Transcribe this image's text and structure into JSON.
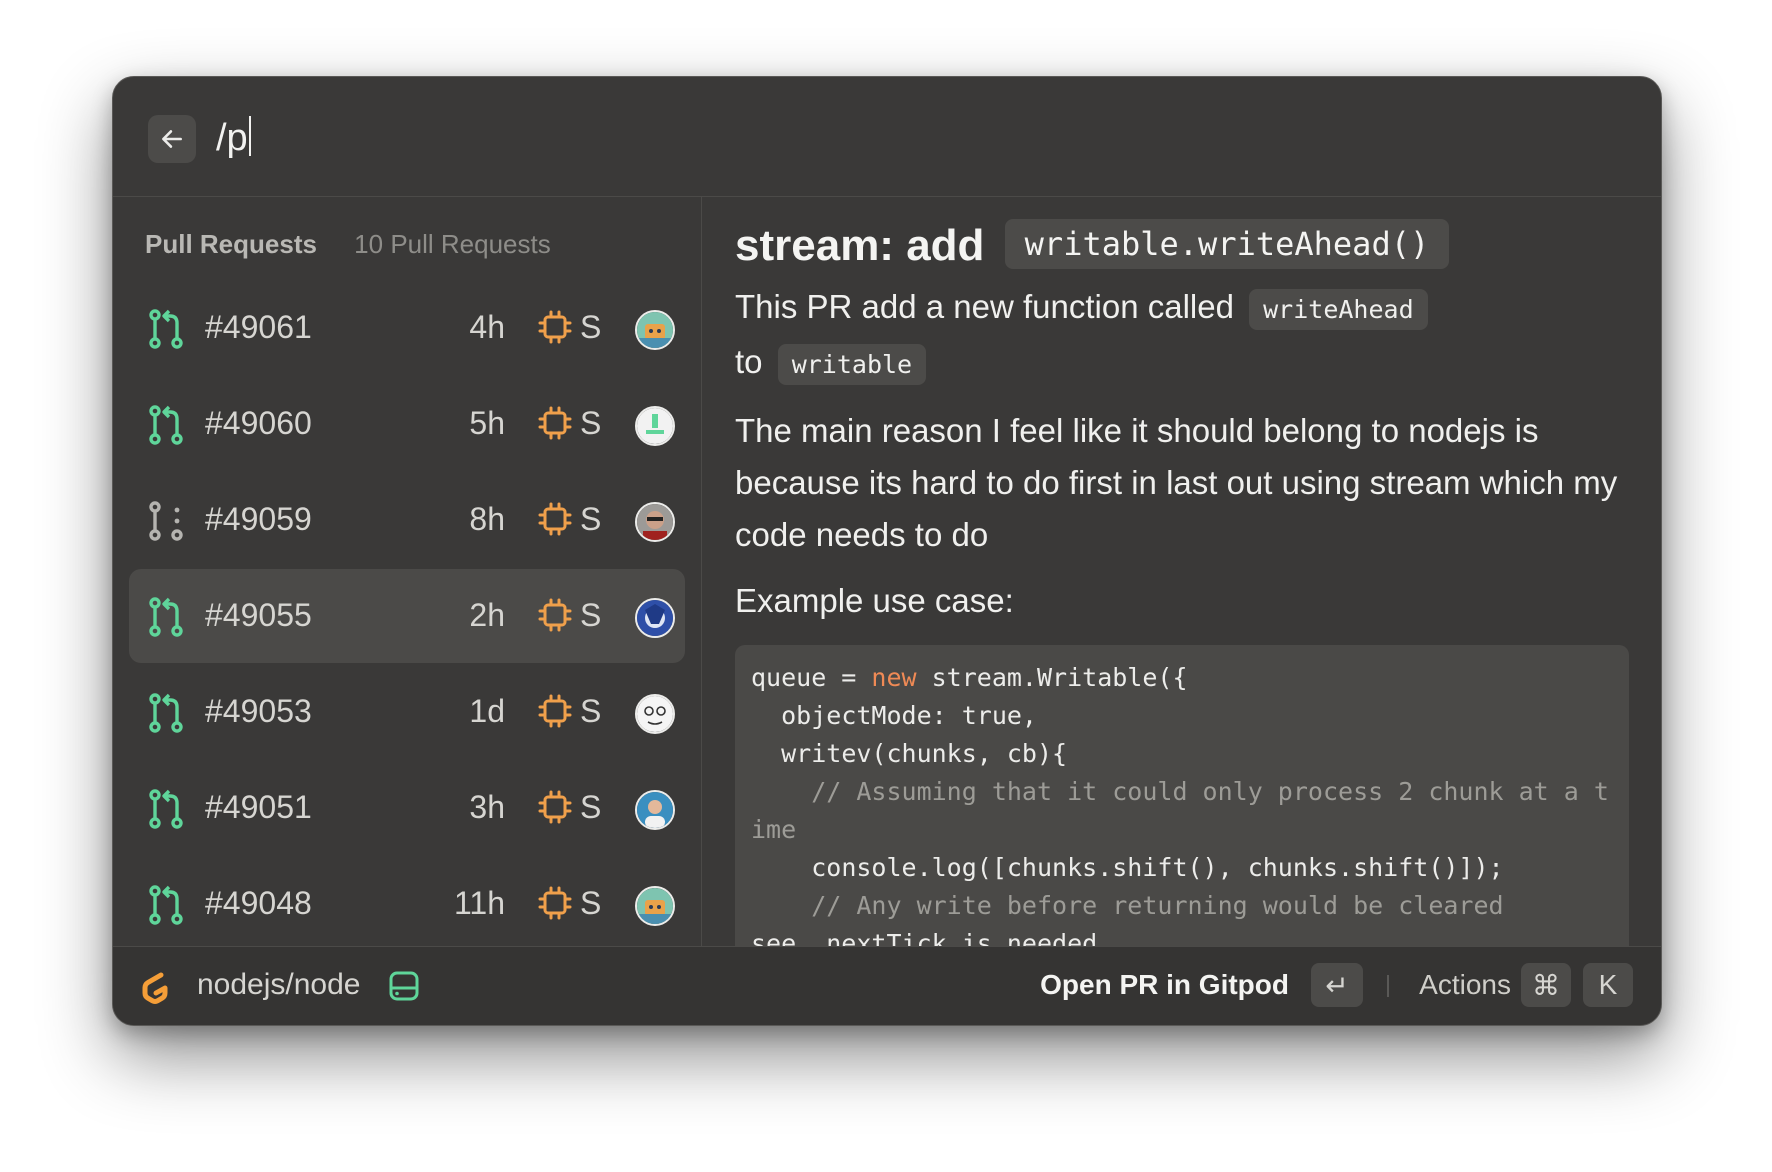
{
  "search": {
    "query": "/p"
  },
  "list": {
    "title": "Pull Requests",
    "count_label": "10 Pull Requests",
    "items": [
      {
        "number": "#49061",
        "age": "4h",
        "size": "S",
        "status": "open",
        "avatar": "avatar-1"
      },
      {
        "number": "#49060",
        "age": "5h",
        "size": "S",
        "status": "open",
        "avatar": "avatar-2"
      },
      {
        "number": "#49059",
        "age": "8h",
        "size": "S",
        "status": "draft",
        "avatar": "avatar-3"
      },
      {
        "number": "#49055",
        "age": "2h",
        "size": "S",
        "status": "open",
        "avatar": "avatar-4",
        "selected": true
      },
      {
        "number": "#49053",
        "age": "1d",
        "size": "S",
        "status": "open",
        "avatar": "avatar-5"
      },
      {
        "number": "#49051",
        "age": "3h",
        "size": "S",
        "status": "open",
        "avatar": "avatar-6"
      },
      {
        "number": "#49048",
        "age": "11h",
        "size": "S",
        "status": "open",
        "avatar": "avatar-1"
      }
    ]
  },
  "detail": {
    "title_prefix": "stream: add",
    "title_code": "writable.writeAhead()",
    "p1_text": "This PR add a new function called",
    "p1_code": "writeAhead",
    "p1_to": "to",
    "p1_code2": "writable",
    "p2": "The main reason I feel like it should belong to nodejs is because its hard to do first in last out using stream which my code needs to do",
    "p3": "Example use case:",
    "code": {
      "l1a": "queue = ",
      "l1kw": "new",
      "l1b": " stream.Writable({",
      "l2": "  objectMode: true,",
      "l3": "  writev(chunks, cb){",
      "l4": "    // Assuming that it could only process 2 chunk at a time",
      "l5": "    console.log([chunks.shift(), chunks.shift()]);",
      "l6": "    // Any write before returning would be cleared",
      "l7": "see .nextTick is needed"
    }
  },
  "footer": {
    "repo": "nodejs/node",
    "primary_action": "Open PR in Gitpod",
    "enter_key": "↵",
    "actions_label": "Actions",
    "cmd_key": "⌘",
    "k_key": "K"
  },
  "colors": {
    "accent_green": "#5fd59a",
    "chip_orange": "#f0a04b",
    "keyword_orange": "#f08a55",
    "gitpod_orange": "#f59e38"
  }
}
